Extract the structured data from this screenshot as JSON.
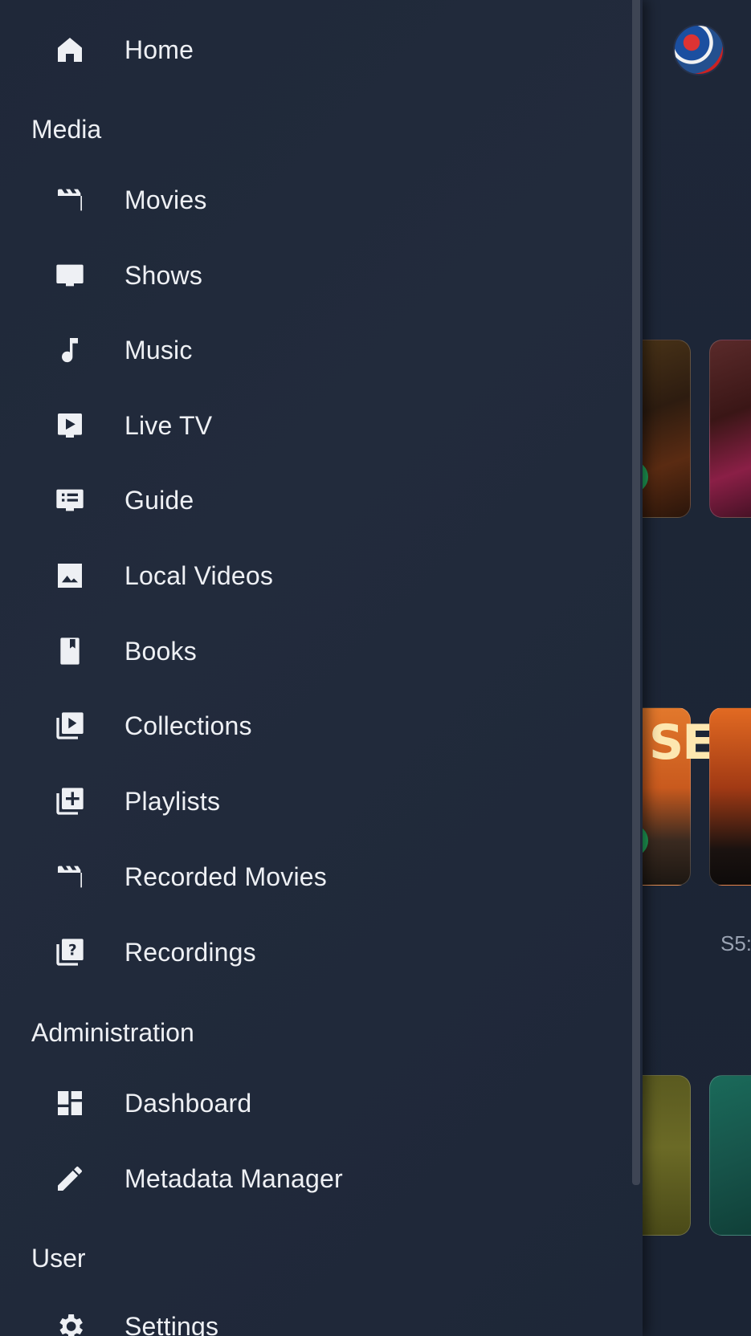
{
  "drawer": {
    "home": {
      "label": "Home",
      "icon": "home-icon"
    },
    "sections": {
      "media": "Media",
      "administration": "Administration",
      "user": "User"
    },
    "media_items": [
      {
        "label": "Movies",
        "icon": "movie-clapper-icon"
      },
      {
        "label": "Shows",
        "icon": "tv-icon"
      },
      {
        "label": "Music",
        "icon": "music-note-icon"
      },
      {
        "label": "Live TV",
        "icon": "live-tv-icon"
      },
      {
        "label": "Guide",
        "icon": "guide-list-icon"
      },
      {
        "label": "Local Videos",
        "icon": "image-icon"
      },
      {
        "label": "Books",
        "icon": "book-icon"
      },
      {
        "label": "Collections",
        "icon": "video-library-icon"
      },
      {
        "label": "Playlists",
        "icon": "playlist-add-icon"
      },
      {
        "label": "Recorded Movies",
        "icon": "movie-clapper-icon"
      },
      {
        "label": "Recordings",
        "icon": "library-question-icon"
      }
    ],
    "admin_items": [
      {
        "label": "Dashboard",
        "icon": "dashboard-icon"
      },
      {
        "label": "Metadata Manager",
        "icon": "pencil-icon"
      }
    ],
    "user_items": [
      {
        "label": "Settings",
        "icon": "gear-icon"
      }
    ]
  },
  "background": {
    "episode_label": "S5:",
    "poster_text": "SE",
    "colors": {
      "play_button": "#20a35a",
      "drawer_bg": "#1f2839"
    }
  }
}
